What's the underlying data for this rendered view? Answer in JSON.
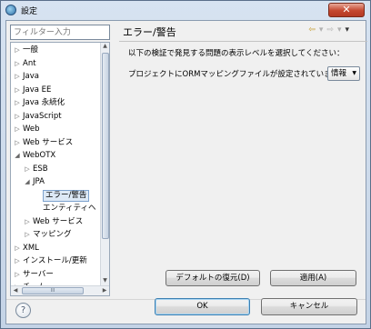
{
  "window": {
    "title": "設定",
    "close_label": "✕"
  },
  "filter": {
    "placeholder": "フィルター入力"
  },
  "tree": {
    "items": [
      {
        "label": "一般",
        "arrow": "▷",
        "depth": 0,
        "selected": false
      },
      {
        "label": "Ant",
        "arrow": "▷",
        "depth": 0,
        "selected": false
      },
      {
        "label": "Java",
        "arrow": "▷",
        "depth": 0,
        "selected": false
      },
      {
        "label": "Java EE",
        "arrow": "▷",
        "depth": 0,
        "selected": false
      },
      {
        "label": "Java 永続化",
        "arrow": "▷",
        "depth": 0,
        "selected": false
      },
      {
        "label": "JavaScript",
        "arrow": "▷",
        "depth": 0,
        "selected": false
      },
      {
        "label": "Web",
        "arrow": "▷",
        "depth": 0,
        "selected": false
      },
      {
        "label": "Web サービス",
        "arrow": "▷",
        "depth": 0,
        "selected": false
      },
      {
        "label": "WebOTX",
        "arrow": "◢",
        "depth": 0,
        "selected": false
      },
      {
        "label": "ESB",
        "arrow": "▷",
        "depth": 1,
        "selected": false
      },
      {
        "label": "JPA",
        "arrow": "◢",
        "depth": 1,
        "selected": false
      },
      {
        "label": "エラー/警告",
        "arrow": "",
        "depth": 2,
        "selected": true
      },
      {
        "label": "エンティティヘ",
        "arrow": "",
        "depth": 2,
        "selected": false
      },
      {
        "label": "Web サービス",
        "arrow": "▷",
        "depth": 1,
        "selected": false
      },
      {
        "label": "マッピング",
        "arrow": "▷",
        "depth": 1,
        "selected": false
      },
      {
        "label": "XML",
        "arrow": "▷",
        "depth": 0,
        "selected": false
      },
      {
        "label": "インストール/更新",
        "arrow": "▷",
        "depth": 0,
        "selected": false
      },
      {
        "label": "サーバー",
        "arrow": "▷",
        "depth": 0,
        "selected": false
      },
      {
        "label": "チーム",
        "arrow": "▷",
        "depth": 0,
        "selected": false
      },
      {
        "label": "データ管理",
        "arrow": "▷",
        "depth": 0,
        "selected": false
      }
    ]
  },
  "page": {
    "title": "エラー/警告",
    "description": "以下の検証で発見する問題の表示レベルを選択してください：",
    "setting_label": "プロジェクトにORMマッピングファイルが設定されていません：",
    "setting_value": "情報"
  },
  "nav": {
    "back": "⇦",
    "back_menu": "▾",
    "forward": "⇨",
    "forward_menu": "▾",
    "view_menu": "▾"
  },
  "buttons": {
    "restore_defaults": "デフォルトの復元(D)",
    "apply": "適用(A)",
    "ok": "OK",
    "cancel": "キャンセル"
  },
  "help": {
    "glyph": "?"
  },
  "scroll": {
    "grip": "III"
  }
}
